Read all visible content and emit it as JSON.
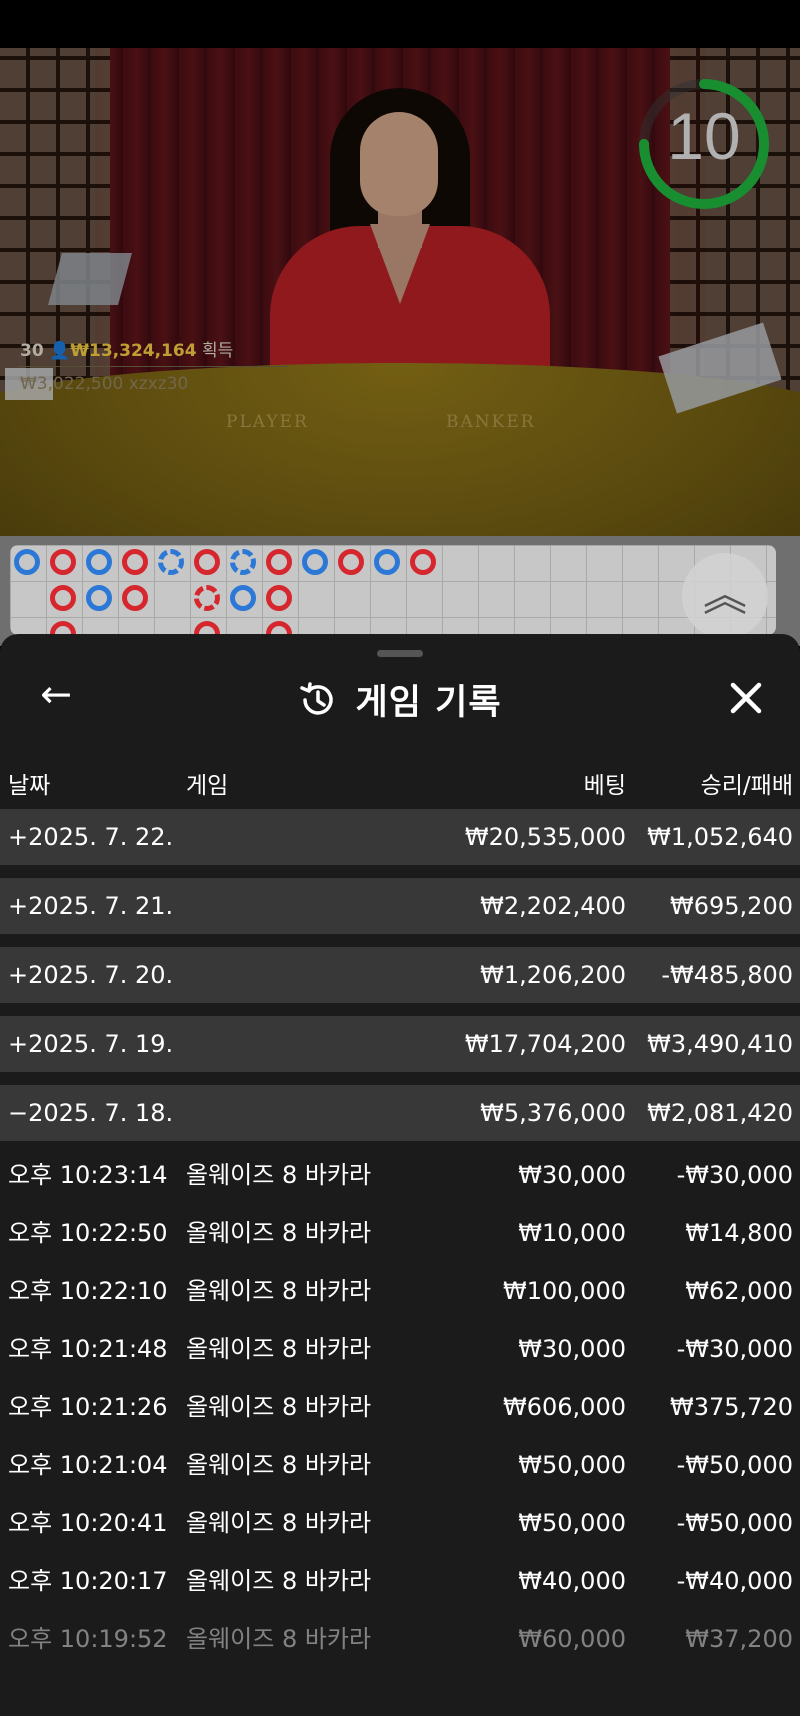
{
  "video": {
    "timer": "10",
    "timer_progress": 0.75,
    "table_labels": [
      "PLAYER",
      "BANKER"
    ],
    "winner_count": "30",
    "winner_amount": "₩13,324,164",
    "winner_suffix": "획득",
    "sub_winner_amount": "₩3,022,500",
    "sub_winner_user": "xzxz30"
  },
  "roadmap": {
    "row1": [
      "b",
      "p",
      "b",
      "p",
      "bs",
      "p",
      "bs",
      "p",
      "b",
      "p",
      "b",
      "p"
    ],
    "row2": [
      "",
      "p",
      "b",
      "p",
      "",
      "ps",
      "b",
      "p",
      "",
      "",
      "",
      ""
    ],
    "row3": [
      "",
      "p",
      "",
      "",
      "",
      "p",
      "",
      "p",
      "",
      "",
      "",
      ""
    ]
  },
  "sheet": {
    "title": "게임 기록",
    "back_icon": "arrow-left-icon",
    "close_icon": "close-icon",
    "history_icon": "history-icon",
    "columns": {
      "date": "날짜",
      "game": "게임",
      "bet": "베팅",
      "win": "승리/패배"
    },
    "summary_rows": [
      {
        "date": "+2025. 7. 22.",
        "bet": "₩20,535,000",
        "win": "₩1,052,640"
      },
      {
        "date": "+2025. 7. 21.",
        "bet": "₩2,202,400",
        "win": "₩695,200"
      },
      {
        "date": "+2025. 7. 20.",
        "bet": "₩1,206,200",
        "win": "-₩485,800"
      },
      {
        "date": "+2025. 7. 19.",
        "bet": "₩17,704,200",
        "win": "₩3,490,410"
      },
      {
        "date": "−2025. 7. 18.",
        "bet": "₩5,376,000",
        "win": "₩2,081,420"
      }
    ],
    "detail_rows": [
      {
        "time": "오후 10:23:14",
        "game": "올웨이즈 8 바카라",
        "bet": "₩30,000",
        "win": "-₩30,000"
      },
      {
        "time": "오후 10:22:50",
        "game": "올웨이즈 8 바카라",
        "bet": "₩10,000",
        "win": "₩14,800"
      },
      {
        "time": "오후 10:22:10",
        "game": "올웨이즈 8 바카라",
        "bet": "₩100,000",
        "win": "₩62,000"
      },
      {
        "time": "오후 10:21:48",
        "game": "올웨이즈 8 바카라",
        "bet": "₩30,000",
        "win": "-₩30,000"
      },
      {
        "time": "오후 10:21:26",
        "game": "올웨이즈 8 바카라",
        "bet": "₩606,000",
        "win": "₩375,720"
      },
      {
        "time": "오후 10:21:04",
        "game": "올웨이즈 8 바카라",
        "bet": "₩50,000",
        "win": "-₩50,000"
      },
      {
        "time": "오후 10:20:41",
        "game": "올웨이즈 8 바카라",
        "bet": "₩50,000",
        "win": "-₩50,000"
      },
      {
        "time": "오후 10:20:17",
        "game": "올웨이즈 8 바카라",
        "bet": "₩40,000",
        "win": "-₩40,000"
      },
      {
        "time": "오후 10:19:52",
        "game": "올웨이즈 8 바카라",
        "bet": "₩60,000",
        "win": "₩37,200"
      }
    ]
  }
}
